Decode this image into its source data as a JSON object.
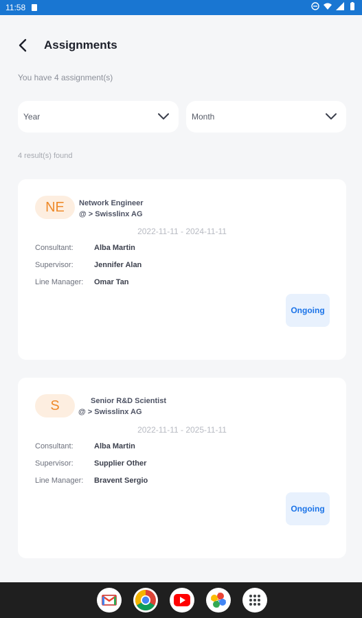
{
  "status_bar": {
    "time": "11:58"
  },
  "header": {
    "title": "Assignments"
  },
  "summary": "You have 4 assignment(s)",
  "filters": {
    "year": "Year",
    "month": "Month"
  },
  "results_text": "4 result(s) found",
  "assignments": [
    {
      "initials": "NE",
      "role": "Network Engineer",
      "company": "@ > Swisslinx AG",
      "dates": "2022-11-11 - 2024-11-11",
      "consultant_label": "Consultant:",
      "consultant": "Alba Martin",
      "supervisor_label": "Supervisor:",
      "supervisor": "Jennifer Alan",
      "line_manager_label": "Line Manager:",
      "line_manager": "Omar Tan",
      "status": "Ongoing"
    },
    {
      "initials": "S",
      "role": "Senior R&D Scientist",
      "company": "@ > Swisslinx AG",
      "dates": "2022-11-11 - 2025-11-11",
      "consultant_label": "Consultant:",
      "consultant": "Alba Martin",
      "supervisor_label": "Supervisor:",
      "supervisor": "Supplier Other",
      "line_manager_label": "Line Manager:",
      "line_manager": "Bravent Sergio",
      "status": "Ongoing"
    }
  ],
  "dock_apps": [
    "gmail-icon",
    "chrome-icon",
    "youtube-icon",
    "photos-icon",
    "app-drawer-icon"
  ],
  "colors": {
    "status_bar": "#1976d2",
    "accent": "#1a73e8",
    "avatar_text": "#ee8a2a",
    "avatar_bg": "#fdeee0"
  }
}
